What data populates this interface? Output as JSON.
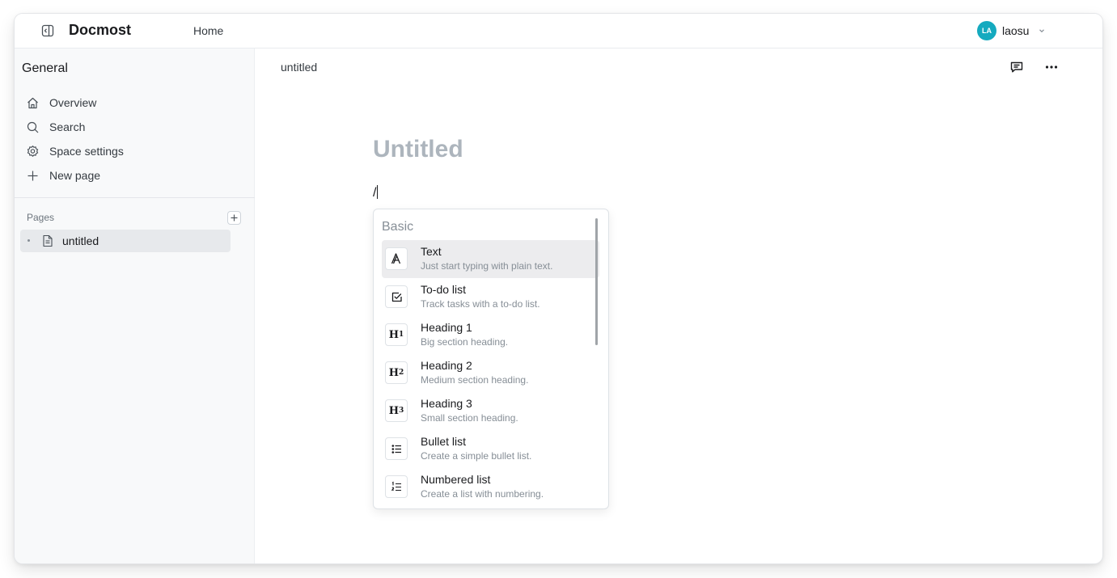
{
  "header": {
    "brand": "Docmost",
    "home_label": "Home",
    "user": {
      "initials": "LA",
      "name": "laosu",
      "avatar_color": "#15aabf"
    }
  },
  "sidebar": {
    "space_title": "General",
    "nav": [
      {
        "label": "Overview",
        "icon": "home-icon"
      },
      {
        "label": "Search",
        "icon": "search-icon"
      },
      {
        "label": "Space settings",
        "icon": "settings-icon"
      },
      {
        "label": "New page",
        "icon": "plus-icon"
      }
    ],
    "pages_label": "Pages",
    "pages": [
      {
        "label": "untitled",
        "icon": "file-icon"
      }
    ]
  },
  "main": {
    "breadcrumb_title": "untitled",
    "doc_title_placeholder": "Untitled",
    "editor_text": "/"
  },
  "slash_menu": {
    "group_label": "Basic",
    "items": [
      {
        "title": "Text",
        "description": "Just start typing with plain text.",
        "icon": "text-icon"
      },
      {
        "title": "To-do list",
        "description": "Track tasks with a to-do list.",
        "icon": "checkbox-icon"
      },
      {
        "title": "Heading 1",
        "description": "Big section heading.",
        "icon": "heading-1-icon"
      },
      {
        "title": "Heading 2",
        "description": "Medium section heading.",
        "icon": "heading-2-icon"
      },
      {
        "title": "Heading 3",
        "description": "Small section heading.",
        "icon": "heading-3-icon"
      },
      {
        "title": "Bullet list",
        "description": "Create a simple bullet list.",
        "icon": "bullet-list-icon"
      },
      {
        "title": "Numbered list",
        "description": "Create a list with numbering.",
        "icon": "numbered-list-icon"
      }
    ],
    "active_index": 0
  }
}
